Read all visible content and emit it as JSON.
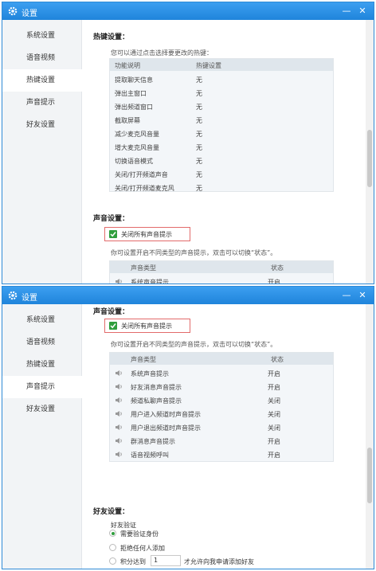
{
  "title": "设置",
  "nav": [
    "系统设置",
    "语音视频",
    "热键设置",
    "声音提示",
    "好友设置"
  ],
  "hotkeys": {
    "title": "热键设置：",
    "hint": "您可以通过点击选择要更改的热键：",
    "col_function": "功能说明",
    "col_setting": "热键设置",
    "rows": [
      {
        "label": "提取聊天信息",
        "value": "无"
      },
      {
        "label": "弹出主窗口",
        "value": "无"
      },
      {
        "label": "弹出频道窗口",
        "value": "无"
      },
      {
        "label": "截取屏幕",
        "value": "无"
      },
      {
        "label": "减少麦克风音量",
        "value": "无"
      },
      {
        "label": "增大麦克风音量",
        "value": "无"
      },
      {
        "label": "切换语音模式",
        "value": "无"
      },
      {
        "label": "关闭/打开频道声音",
        "value": "无"
      },
      {
        "label": "关闭/打开频道麦克风",
        "value": "无"
      }
    ]
  },
  "sound": {
    "title": "声音设置：",
    "mute_all_label": "关闭所有声音提示",
    "mute_all_checked": true,
    "hint": "你可设置开启不同类型的声音提示，双击可以切换“状态”。",
    "col_type": "声音类型",
    "col_status": "状态",
    "rows": [
      {
        "label": "系统声音提示",
        "status": "开启"
      },
      {
        "label": "好友消息声音提示",
        "status": "开启"
      },
      {
        "label": "频道私聊声音提示",
        "status": "关闭"
      },
      {
        "label": "用户进入频道时声音提示",
        "status": "关闭"
      },
      {
        "label": "用户退出频道时声音提示",
        "status": "关闭"
      },
      {
        "label": "群消息声音提示",
        "status": "开启"
      },
      {
        "label": "语音视频呼叫",
        "status": "开启"
      }
    ]
  },
  "friends": {
    "title": "好友设置：",
    "verify_label": "好友验证",
    "options": [
      "需要验证身份",
      "拒绝任何人添加",
      "积分达到"
    ],
    "selected_option": 0,
    "points_value": "1",
    "points_suffix": "才允许向我申请添加好友"
  },
  "colors": {
    "titlebar": "#2f8ad6",
    "check": "#2f9e3d",
    "highlight_box": "#e26b6b"
  }
}
